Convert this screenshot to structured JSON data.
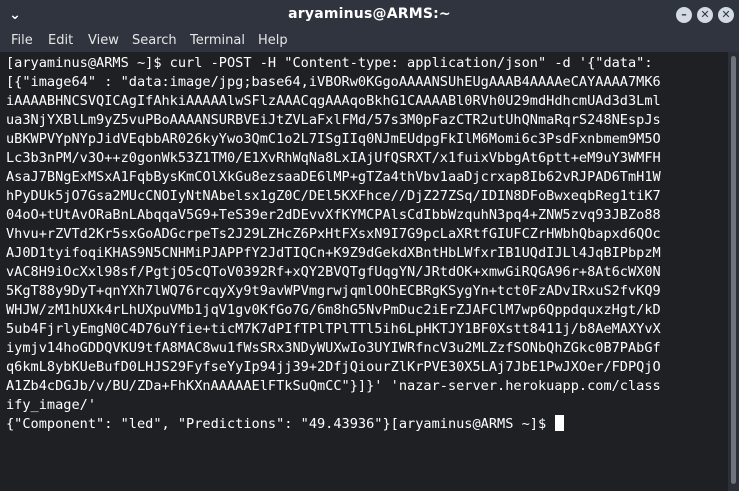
{
  "window": {
    "title": "aryaminus@ARMS:~",
    "controls": {
      "minimize": "–",
      "maximize": "✕",
      "close": "✕"
    }
  },
  "menubar": {
    "items": [
      "File",
      "Edit",
      "View",
      "Search",
      "Terminal",
      "Help"
    ]
  },
  "terminal": {
    "lines": [
      "[aryaminus@ARMS ~]$ curl -POST -H \"Content-type: application/json\" -d '{\"data\":",
      "[{\"image64\" : \"data:image/jpg;base64,iVBORw0KGgoAAAANSUhEUgAAAB4AAAAeCAYAAAA7MK6",
      "iAAAABHNCSVQICAgIfAhkiAAAAAlwSFlzAAACqgAAAqoBkhG1CAAAABl0RVh0U29mdHdhcmUAd3d3Lml",
      "ua3NjYXBlLm9yZ5vuPBoAAAANSURBVEiJtZVLaFxlFMd/57s3M0pFazCTR2utUhQNmaRqrS248NEspJs",
      "uBKWPVYpNYpJidVEqbbAR026kyYwo3QmC1o2L7ISgIIq0NJmEUdpgFkIlM6Momi6c3PsdFxnbmem9M5O",
      "Lc3b3nPM/v3O++z0gonWk53Z1TM0/E1XvRhWqNa8LxIAjUfQSRXT/x1fuixVbbgAt6ptt+eM9uY3WMFH",
      "AsaJ7BNgExMSxA1FqbBysKmCOlXkGu8ezsaaDE6lMP+gTZa4thVbv1aaDjcrxap8Ib62vRJPAD6TmH1W",
      "hPyDUk5jO7Gsa2MUcCNOIyNtNAbelsx1gZ0C/DEl5KXFhce//DjZ27ZSq/IDIN8DFoBwxeqbReg1tiK7",
      "04oO+tUtAvORaBnLAbqqaV5G9+TeS39er2dDEvvXfKYMCPAlsCdIbbWzquhN3pq4+ZNW5zvq93JBZo88",
      "Vhvu+rZVTd2Kr5sxGoADGcrpeTs2J29LZHcZ6PxHtFXsxN9I7G9pcLaXRtfGIUFCZrHWbhQbapxd6QOc",
      "AJ0D1tyifoqiKHAS9N5CNHMiPJAPPfY2JdTIQCn+K9Z9dGekdXBntHbLWfxrIB1UQdIJLl4JqBIPbpzM",
      "vAC8H9iOcXxl98sf/PgtjO5cQToV0392Rf+xQY2BVQTgfUqgYN/JRtdOK+xmwGiRQGA96r+8At6cWX0N",
      "5KgT88y9DyT+qnYXh7lWQ76rcqyXy9t9avWPVmgrwjqmlOOhECBRgKSygYn+tct0FzADvIRxuS2fvKQ9",
      "WHJW/zM1hUXk4rLhUXpuVMb1jqV1gv0KfGo7G/6m8hG5NvPmDuc2iErZJAFClM7wp6QppdquxzHgt/kD",
      "5ub4FjrlyEmgN0C4D76uYfie+ticM7K7dPIfTPlTPlTTl5ih6LpHKTJY1BF0Xstt8411j/b8AeMAXYvX",
      "iymjv14hoGDDQVKU9tfA8MAC8wu1fWsSRx3NDyWUXwIo3UYIWRfncV3u2MLZzfSONbQhZGkc0B7PAbGf",
      "q6kmL8ybKUeBufD0LHJS29FyfseYyIp94jj39+2DfjQiourZlKrPVE30X5LAj7JbE1PwJXOer/FDPQjO",
      "A1Zb4cDGJb/v/BU/ZDa+FhKXnAAAAAElFTkSuQmCC\"}]}' 'nazar-server.herokuapp.com/class",
      "ify_image/'",
      "{\"Component\": \"led\", \"Predictions\": \"49.43936\"}[aryaminus@ARMS ~]$ "
    ]
  },
  "colors": {
    "titlebar": "#2f343f",
    "terminal_bg": "#1e2023",
    "text": "#ffffff"
  },
  "icons": {
    "window_menu": "chevron-down-icon",
    "minimize": "minimize-icon",
    "maximize": "maximize-icon",
    "close": "close-icon"
  }
}
